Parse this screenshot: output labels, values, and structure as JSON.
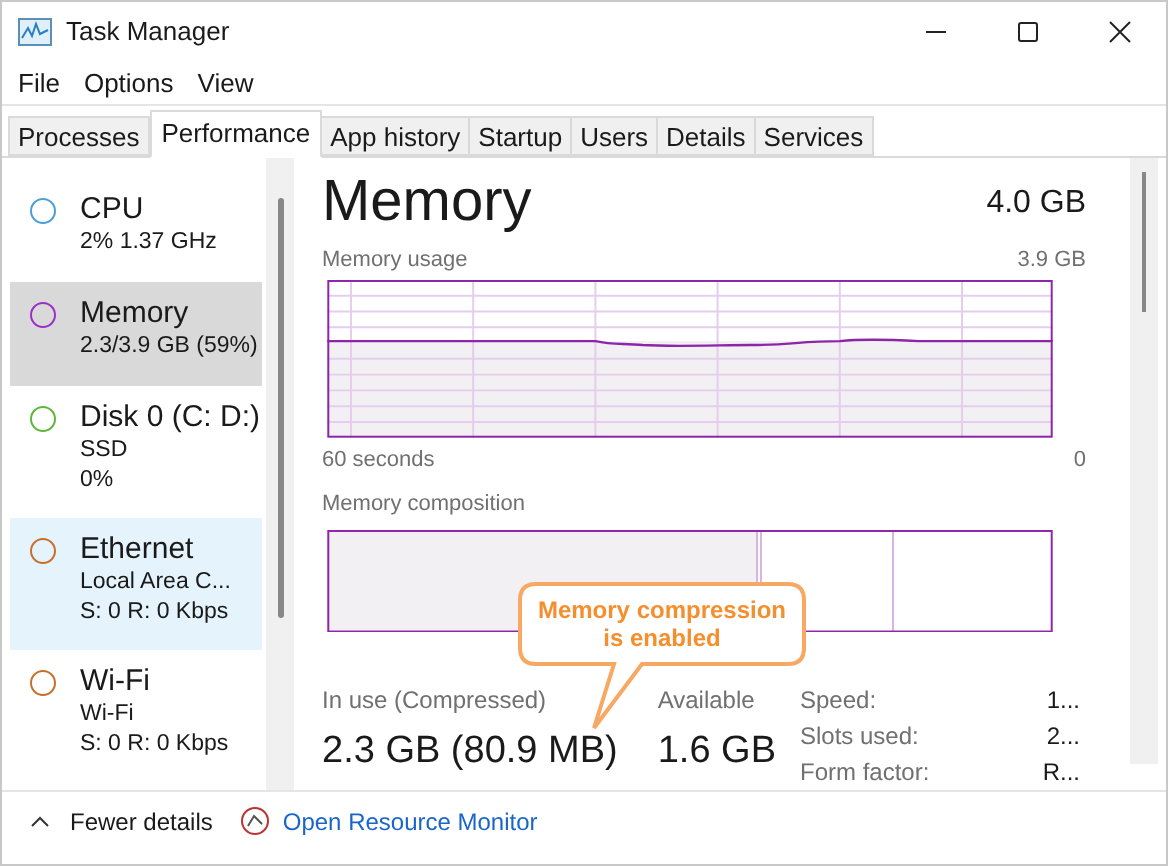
{
  "window": {
    "title": "Task Manager"
  },
  "menu": [
    "File",
    "Options",
    "View"
  ],
  "tabs": [
    {
      "label": "Processes",
      "selected": false
    },
    {
      "label": "Performance",
      "selected": true
    },
    {
      "label": "App history",
      "selected": false
    },
    {
      "label": "Startup",
      "selected": false
    },
    {
      "label": "Users",
      "selected": false
    },
    {
      "label": "Details",
      "selected": false
    },
    {
      "label": "Services",
      "selected": false
    }
  ],
  "sidebar": {
    "items": [
      {
        "title": "CPU",
        "lines": [
          "2% 1.37 GHz"
        ],
        "color": "#4a9fd8",
        "selected": false,
        "hovered": false
      },
      {
        "title": "Memory",
        "lines": [
          "2.3/3.9 GB (59%)"
        ],
        "color": "#9b30c8",
        "selected": true,
        "hovered": false
      },
      {
        "title": "Disk 0 (C: D:)",
        "lines": [
          "SSD",
          "0%"
        ],
        "color": "#5cb83a",
        "selected": false,
        "hovered": false
      },
      {
        "title": "Ethernet",
        "lines": [
          "Local Area C...",
          "S: 0 R: 0 Kbps"
        ],
        "color": "#c8702a",
        "selected": false,
        "hovered": true
      },
      {
        "title": "Wi-Fi",
        "lines": [
          "Wi-Fi",
          "S: 0 R: 0 Kbps"
        ],
        "color": "#c8702a",
        "selected": false,
        "hovered": false
      }
    ]
  },
  "detail": {
    "title": "Memory",
    "total": "4.0 GB",
    "usage_graph": {
      "label": "Memory usage",
      "max": "3.9 GB",
      "time_label": "60 seconds",
      "min": "0"
    },
    "composition_label": "Memory composition",
    "stats": [
      {
        "label": "In use (Compressed)",
        "value": "2.3 GB (80.9 MB)"
      },
      {
        "label": "Available",
        "value": "1.6 GB"
      }
    ],
    "properties": [
      {
        "label": "Speed:",
        "value": "1..."
      },
      {
        "label": "Slots used:",
        "value": "2..."
      },
      {
        "label": "Form factor:",
        "value": "R..."
      }
    ]
  },
  "callout": "Memory compression is enabled",
  "footer": {
    "fewer_details": "Fewer details",
    "resource_monitor": "Open Resource Monitor"
  }
}
